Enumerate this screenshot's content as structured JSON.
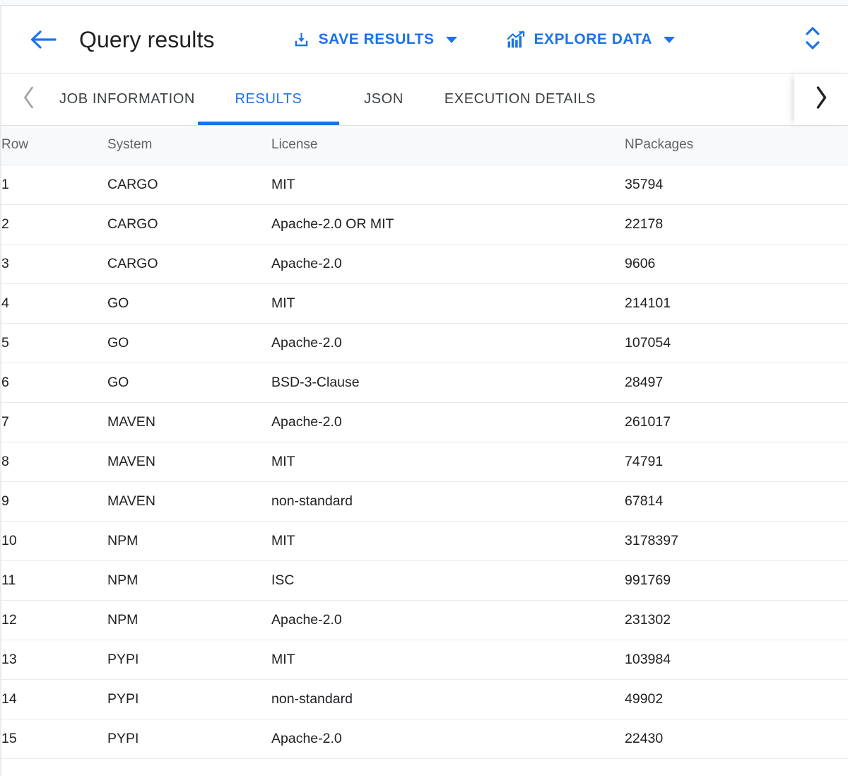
{
  "colors": {
    "accent": "#1a73e8",
    "text_primary": "#202124",
    "text_secondary": "#5f6368",
    "header_bg": "#f8f9fa",
    "border": "#e8eaed",
    "page_bg": "#f1f3f4"
  },
  "header": {
    "back_icon": "arrow-left-icon",
    "title": "Query results",
    "actions": [
      {
        "icon": "save-download-icon",
        "label": "SAVE RESULTS",
        "has_caret": true
      },
      {
        "icon": "bar-chart-trend-icon",
        "label": "EXPLORE DATA",
        "has_caret": true
      }
    ],
    "expand_icon": "unfold-more-icon"
  },
  "tabbar": {
    "scroll_left_icon": "chevron-left-icon",
    "scroll_right_icon": "chevron-right-icon",
    "tabs": [
      {
        "label": "JOB INFORMATION",
        "active": false
      },
      {
        "label": "RESULTS",
        "active": true
      },
      {
        "label": "JSON",
        "active": false
      },
      {
        "label": "EXECUTION DETAILS",
        "active": false
      }
    ]
  },
  "table": {
    "columns": [
      "Row",
      "System",
      "License",
      "NPackages"
    ],
    "rows": [
      {
        "row": "1",
        "system": "CARGO",
        "license": "MIT",
        "npackages": "35794"
      },
      {
        "row": "2",
        "system": "CARGO",
        "license": "Apache-2.0 OR MIT",
        "npackages": "22178"
      },
      {
        "row": "3",
        "system": "CARGO",
        "license": "Apache-2.0",
        "npackages": "9606"
      },
      {
        "row": "4",
        "system": "GO",
        "license": "MIT",
        "npackages": "214101"
      },
      {
        "row": "5",
        "system": "GO",
        "license": "Apache-2.0",
        "npackages": "107054"
      },
      {
        "row": "6",
        "system": "GO",
        "license": "BSD-3-Clause",
        "npackages": "28497"
      },
      {
        "row": "7",
        "system": "MAVEN",
        "license": "Apache-2.0",
        "npackages": "261017"
      },
      {
        "row": "8",
        "system": "MAVEN",
        "license": "MIT",
        "npackages": "74791"
      },
      {
        "row": "9",
        "system": "MAVEN",
        "license": "non-standard",
        "npackages": "67814"
      },
      {
        "row": "10",
        "system": "NPM",
        "license": "MIT",
        "npackages": "3178397"
      },
      {
        "row": "11",
        "system": "NPM",
        "license": "ISC",
        "npackages": "991769"
      },
      {
        "row": "12",
        "system": "NPM",
        "license": "Apache-2.0",
        "npackages": "231302"
      },
      {
        "row": "13",
        "system": "PYPI",
        "license": "MIT",
        "npackages": "103984"
      },
      {
        "row": "14",
        "system": "PYPI",
        "license": "non-standard",
        "npackages": "49902"
      },
      {
        "row": "15",
        "system": "PYPI",
        "license": "Apache-2.0",
        "npackages": "22430"
      }
    ]
  }
}
